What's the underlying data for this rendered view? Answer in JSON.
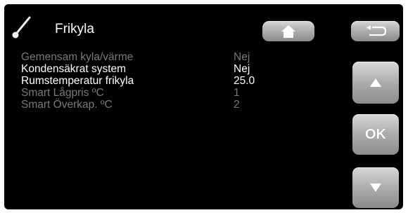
{
  "header": {
    "title": "Frikyla"
  },
  "buttons": {
    "ok_label": "OK"
  },
  "rows": [
    {
      "label": "Gemensam kyla/värme",
      "value": "Nej",
      "active": false
    },
    {
      "label": "Kondensäkrat system",
      "value": "Nej",
      "active": true
    },
    {
      "label": "Rumstemperatur frikyla",
      "value": "25.0",
      "active": true
    },
    {
      "label": "Smart Lågpris ºC",
      "value": "1",
      "active": false
    },
    {
      "label": "Smart Överkap. ºC",
      "value": "2",
      "active": false
    }
  ],
  "colors": {
    "background": "#000000",
    "active_text": "#ffffff",
    "inactive_text": "#7a7a7a",
    "button": "#b0b0b0"
  },
  "icons": {
    "header": "thermometer-icon",
    "home": "home-icon",
    "back": "back-arrow-icon",
    "up": "arrow-up-icon",
    "down": "arrow-down-icon"
  }
}
